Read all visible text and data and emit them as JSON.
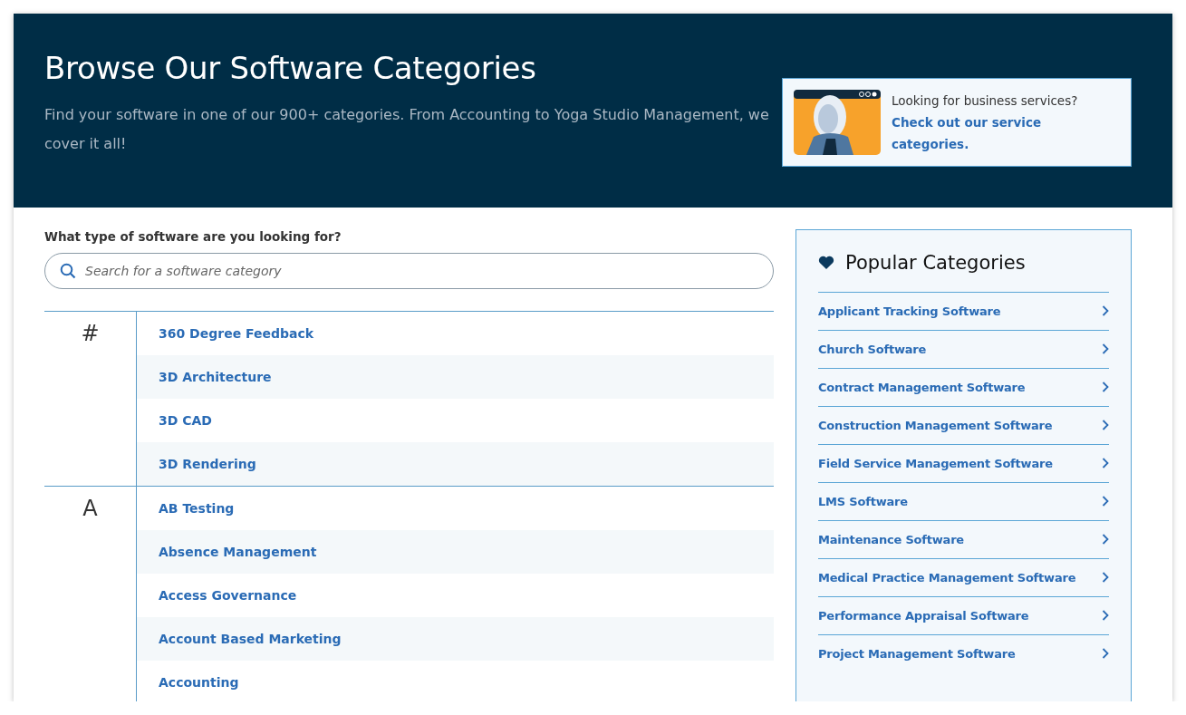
{
  "header": {
    "title": "Browse Our Software Categories",
    "subtitle": "Find your software in one of our 900+ categories. From Accounting to Yoga Studio Management, we cover it all!",
    "promo": {
      "question": "Looking for business services?",
      "link": "Check out our service categories."
    }
  },
  "search": {
    "label": "What type of software are you looking for?",
    "placeholder": "Search for a software category"
  },
  "groups": [
    {
      "letter": "#",
      "items": [
        "360 Degree Feedback",
        "3D Architecture",
        "3D CAD",
        "3D Rendering"
      ]
    },
    {
      "letter": "A",
      "items": [
        "AB Testing",
        "Absence Management",
        "Access Governance",
        "Account Based Marketing",
        "Accounting"
      ]
    }
  ],
  "popular": {
    "title": "Popular Categories",
    "items": [
      "Applicant Tracking Software",
      "Church Software",
      "Contract Management Software",
      "Construction Management Software",
      "Field Service Management Software",
      "LMS Software",
      "Maintenance Software",
      "Medical Practice Management Software",
      "Performance Appraisal Software",
      "Project Management Software"
    ]
  }
}
